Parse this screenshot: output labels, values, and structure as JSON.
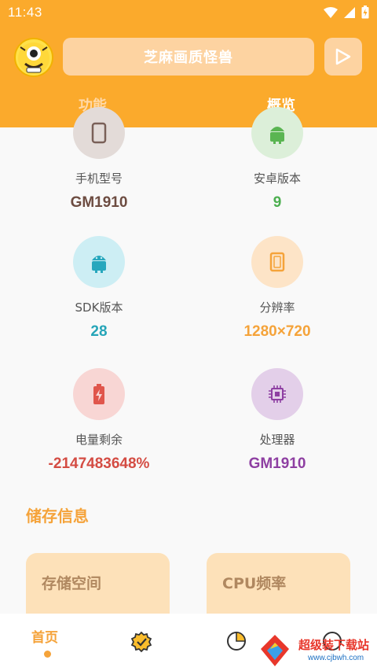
{
  "status": {
    "time": "11:43"
  },
  "header": {
    "app_title": "芝麻画质怪兽",
    "tabs": [
      {
        "label": "功能",
        "active": false
      },
      {
        "label": "概览",
        "active": true
      }
    ]
  },
  "overview": {
    "items": [
      {
        "label": "手机型号",
        "value": "GM1910",
        "color": "#6d4c41",
        "circle": "#e3dbd8",
        "icon": "phone-icon"
      },
      {
        "label": "安卓版本",
        "value": "9",
        "color": "#4caf50",
        "circle": "#dcefd9",
        "icon": "android-icon"
      },
      {
        "label": "SDK版本",
        "value": "28",
        "color": "#26a5b8",
        "circle": "#cdeef4",
        "icon": "android-sdk-icon"
      },
      {
        "label": "分辨率",
        "value": "1280×720",
        "color": "#f5a33a",
        "circle": "#fde4c7",
        "icon": "screen-icon"
      },
      {
        "label": "电量剩余",
        "value": "-2147483648%",
        "color": "#d44c43",
        "circle": "#f8d6d4",
        "icon": "battery-icon"
      },
      {
        "label": "处理器",
        "value": "GM1910",
        "color": "#8e3fa2",
        "circle": "#e3cfe9",
        "icon": "cpu-icon"
      }
    ]
  },
  "storage": {
    "section_title": "储存信息",
    "cards": [
      {
        "title": "存储空间"
      },
      {
        "title": "CPU频率"
      }
    ]
  },
  "bottom_nav": {
    "home_label": "首页"
  },
  "watermark": {
    "brand": "超级装下载站",
    "url": "www.cjbwh.com"
  }
}
